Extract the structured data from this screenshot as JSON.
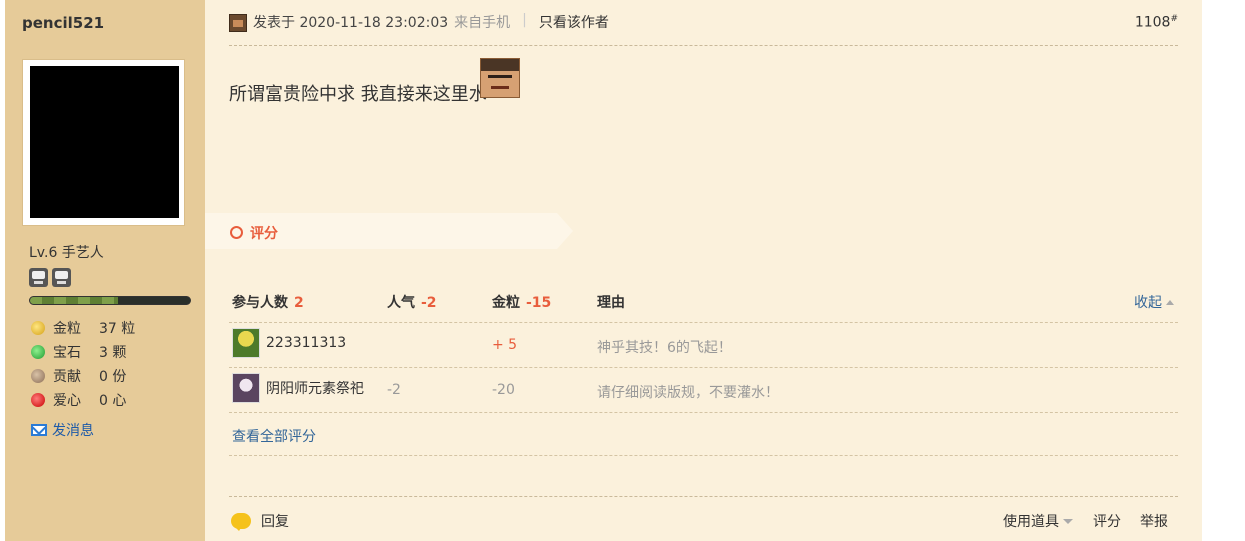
{
  "sidebar": {
    "username": "pencil521",
    "level": "Lv.6 手艺人",
    "exp_fraction": 0.55,
    "stats": [
      {
        "icon": "gold-icon",
        "label": "金粒",
        "value": "37 粒"
      },
      {
        "icon": "gem-icon",
        "label": "宝石",
        "value": "3 颗"
      },
      {
        "icon": "contribution-icon",
        "label": "贡献",
        "value": "0 份"
      },
      {
        "icon": "heart-icon",
        "label": "爱心",
        "value": "0 心"
      }
    ],
    "message_label": "发消息"
  },
  "post": {
    "posted_at": "发表于 2020-11-18 23:02:03",
    "from": "来自手机",
    "separator": "|",
    "author_only": "只看该作者",
    "floor": "1108",
    "floor_sup": "#",
    "content": "所谓富贵险中求 我直接来这里水"
  },
  "rating": {
    "banner_label": "评分",
    "headers": {
      "participants_label": "参与人数",
      "participants_value": "2",
      "popularity_label": "人气",
      "popularity_value": "-2",
      "gold_label": "金粒",
      "gold_value": "-15",
      "reason_label": "理由",
      "collapse_label": "收起"
    },
    "rows": [
      {
        "user": "223311313",
        "popularity": "",
        "gold": "+ 5",
        "reason": "神乎其技！6的飞起！"
      },
      {
        "user": "阴阳师元素祭祀",
        "popularity": "-2",
        "gold": "-20",
        "reason": "请仔细阅读版规，不要灌水！"
      }
    ],
    "view_all": "查看全部评分"
  },
  "footer": {
    "reply": "回复",
    "tools": "使用道具",
    "rate": "评分",
    "report": "举报"
  }
}
